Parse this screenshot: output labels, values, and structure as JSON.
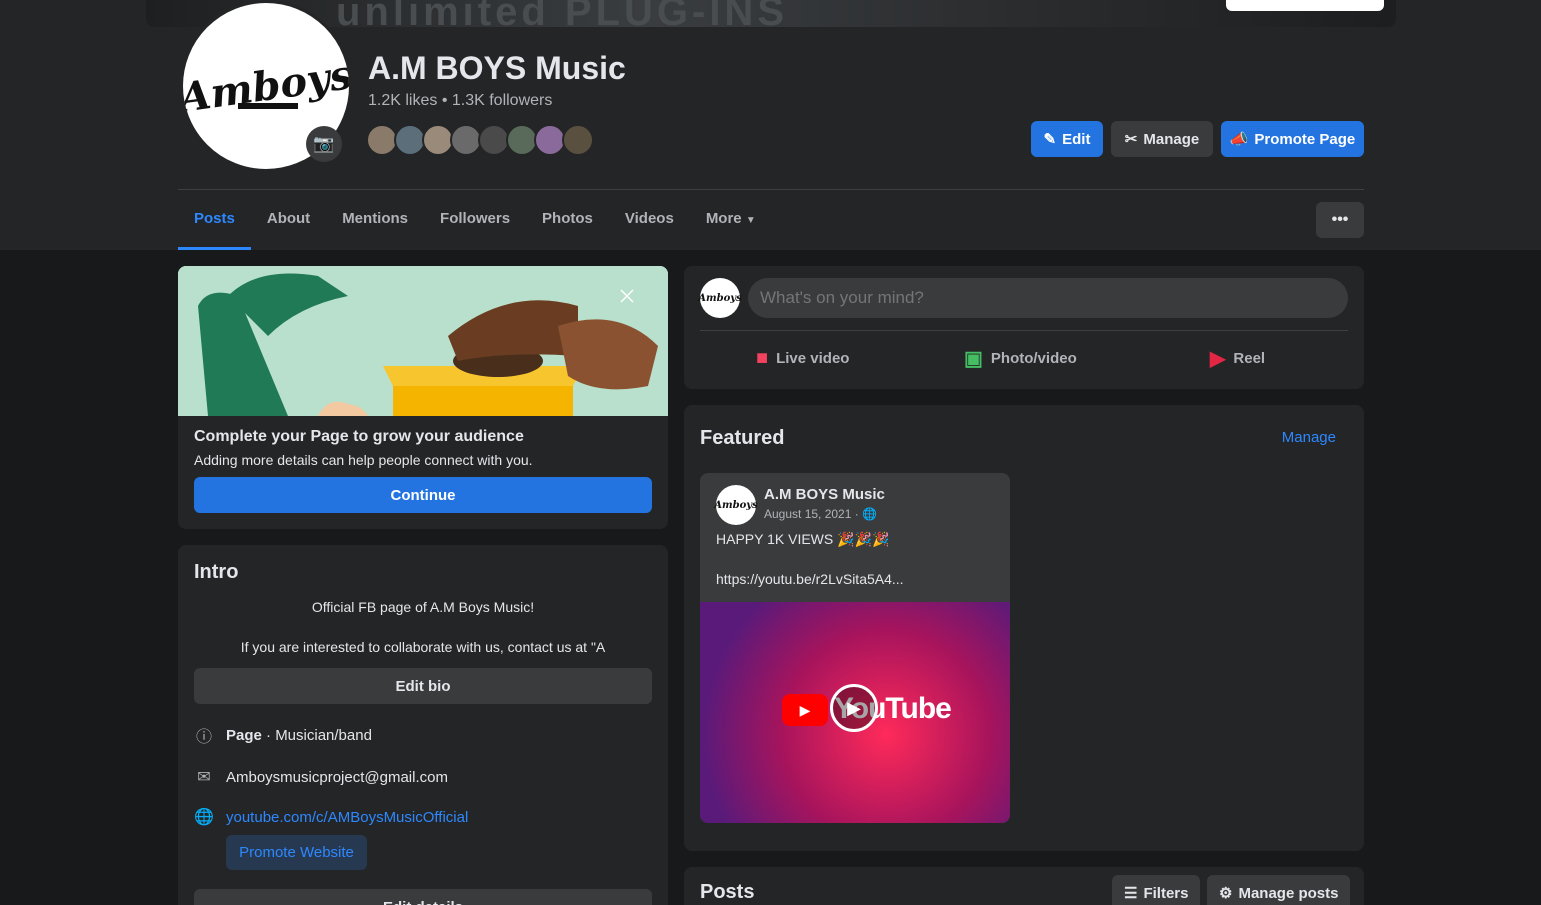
{
  "cover": {
    "text": "unlimited PLUG-INS"
  },
  "profile": {
    "name": "A.M BOYS Music",
    "stats": "1.2K likes • 1.3K followers",
    "avatar_logo": "Amboys"
  },
  "actions": {
    "edit": "Edit",
    "manage": "Manage",
    "promote": "Promote Page"
  },
  "tabs": [
    {
      "label": "Posts"
    },
    {
      "label": "About"
    },
    {
      "label": "Mentions"
    },
    {
      "label": "Followers"
    },
    {
      "label": "Photos"
    },
    {
      "label": "Videos"
    },
    {
      "label": "More"
    }
  ],
  "more_dots": "•••",
  "promo": {
    "title": "Complete your Page to grow your audience",
    "subtitle": "Adding more details can help people connect with you.",
    "button": "Continue"
  },
  "intro": {
    "title": "Intro",
    "bio_line1": "Official FB page of A.M Boys Music!",
    "bio_line2": "If you are interested to collaborate with us, contact us at \"A",
    "edit_bio": "Edit bio",
    "page_label": "Page",
    "page_category": " · Musician/band",
    "email": "Amboysmusicproject@gmail.com",
    "website": "youtube.com/c/AMBoysMusicOfficial",
    "promote_website": "Promote Website",
    "edit_details": "Edit details"
  },
  "composer": {
    "placeholder": "What's on your mind?",
    "live": "Live video",
    "photo": "Photo/video",
    "reel": "Reel",
    "avatar": "Amboys"
  },
  "featured": {
    "title": "Featured",
    "manage": "Manage",
    "post": {
      "author": "A.M BOYS Music",
      "date": "August 15, 2021 ·",
      "text": "HAPPY 1K VIEWS 🎉🎉🎉",
      "link": "https://youtu.be/r2LvSita5A4...",
      "media_word": "YouTube"
    }
  },
  "posts": {
    "title": "Posts",
    "filters": "Filters",
    "manage_posts": "Manage posts"
  },
  "colors": {
    "accent": "#2374e1",
    "link": "#2d88ff",
    "bg": "#18191a",
    "card": "#242526"
  }
}
